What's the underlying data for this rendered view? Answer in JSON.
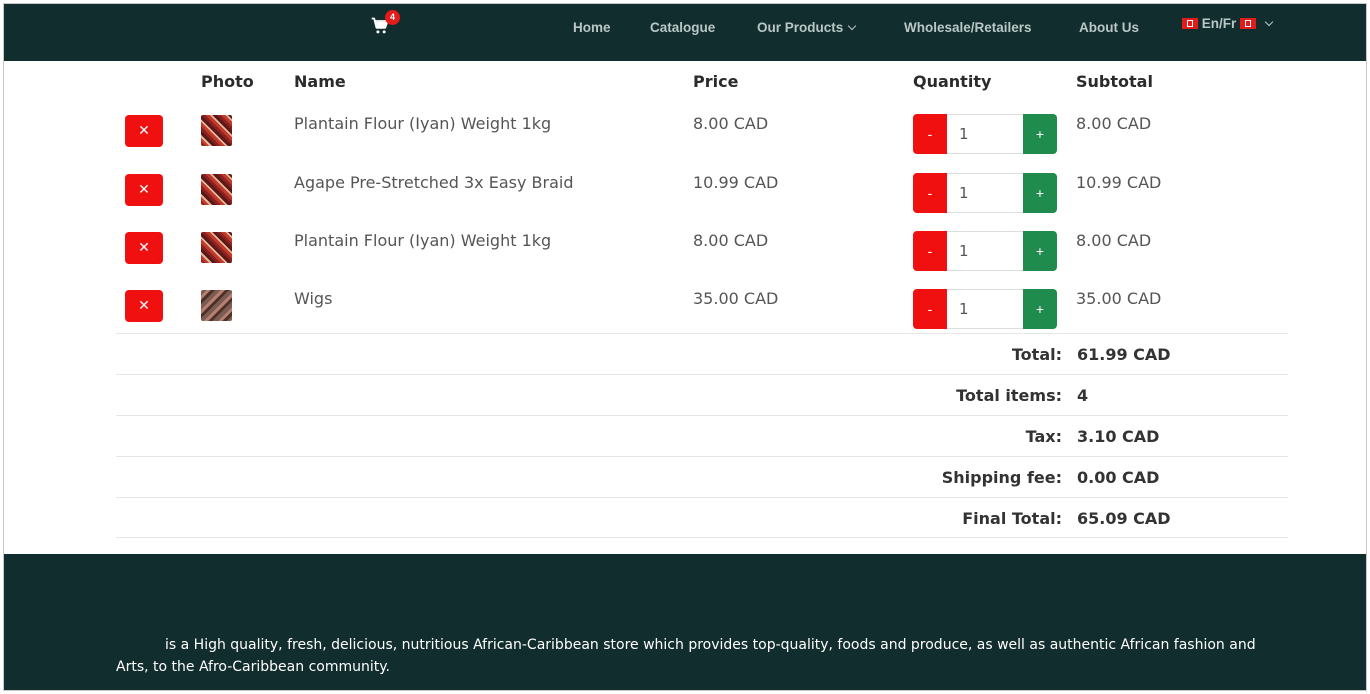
{
  "header": {
    "cart_count": "4",
    "nav": {
      "home": "Home",
      "catalogue": "Catalogue",
      "our_products": "Our Products",
      "wholesale": "Wholesale/Retailers",
      "about": "About Us",
      "language": "En/Fr"
    }
  },
  "cart_table": {
    "headers": {
      "photo": "Photo",
      "name": "Name",
      "price": "Price",
      "quantity": "Quantity",
      "subtotal": "Subtotal"
    },
    "remove_label": "✕",
    "minus_label": "-",
    "plus_label": "+",
    "items": [
      {
        "name": "Plantain Flour (Iyan) Weight 1kg",
        "price": "8.00 CAD",
        "quantity": "1",
        "subtotal": "8.00 CAD"
      },
      {
        "name": "Agape Pre-Stretched 3x Easy Braid",
        "price": "10.99 CAD",
        "quantity": "1",
        "subtotal": "10.99 CAD"
      },
      {
        "name": "Plantain Flour (Iyan) Weight 1kg",
        "price": "8.00 CAD",
        "quantity": "1",
        "subtotal": "8.00 CAD"
      },
      {
        "name": "Wigs",
        "price": "35.00 CAD",
        "quantity": "1",
        "subtotal": "35.00 CAD"
      }
    ]
  },
  "summary": {
    "total_label": "Total:",
    "total_value": "61.99 CAD",
    "items_label": "Total items:",
    "items_value": "4",
    "tax_label": "Tax:",
    "tax_value": "3.10 CAD",
    "shipping_label": "Shipping fee:",
    "shipping_value": "0.00 CAD",
    "final_label": "Final Total:",
    "final_value": "65.09 CAD"
  },
  "footer": {
    "description": "is a High quality, fresh, delicious, nutritious African-Caribbean store which provides top-quality, foods and produce, as well as authentic African fashion and Arts, to the Afro-Caribbean community."
  },
  "colors": {
    "header_bg": "#122d2d",
    "remove_red": "#f01010",
    "plus_green": "#1f8b4c"
  }
}
